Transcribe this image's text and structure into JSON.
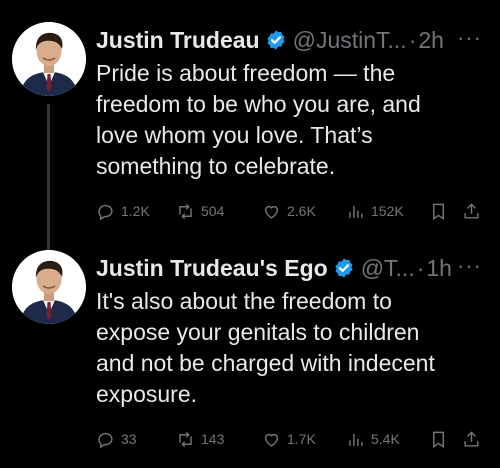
{
  "colors": {
    "background": "#000000",
    "text": "#e7e9ea",
    "muted": "#71767b",
    "verified_blue": "#1d9bf0",
    "thread_line": "#333639"
  },
  "tweets": [
    {
      "author_name": "Justin Trudeau",
      "handle": "@JustinT...",
      "separator": "·",
      "time": "2h",
      "more": "···",
      "lines": [
        "Pride is about freedom — the",
        "freedom to be who you are, and",
        "love whom you love. That’s",
        "something to celebrate."
      ],
      "replies": "1.2K",
      "retweets": "504",
      "likes": "2.6K",
      "views": "152K",
      "icons": [
        "verified-badge-icon",
        "reply-icon",
        "retweet-icon",
        "like-icon",
        "views-icon",
        "bookmark-icon",
        "share-icon"
      ]
    },
    {
      "author_name": "Justin Trudeau's Ego",
      "handle": "@T...",
      "separator": "·",
      "time": "1h",
      "more": "···",
      "lines": [
        "It's also about the freedom to",
        "expose your genitals to children",
        "and not be charged with indecent",
        "exposure."
      ],
      "replies": "33",
      "retweets": "143",
      "likes": "1.7K",
      "views": "5.4K",
      "icons": [
        "verified-badge-icon",
        "reply-icon",
        "retweet-icon",
        "like-icon",
        "views-icon",
        "bookmark-icon",
        "share-icon"
      ]
    }
  ]
}
